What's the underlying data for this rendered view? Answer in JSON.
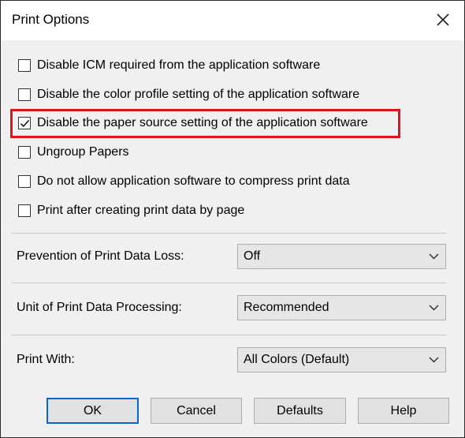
{
  "dialog": {
    "title": "Print Options",
    "close_icon": "close-icon"
  },
  "checkboxes": [
    {
      "label": "Disable ICM required from the application software",
      "checked": false
    },
    {
      "label": "Disable the color profile setting of the application software",
      "checked": false
    },
    {
      "label": "Disable the paper source setting of the application software",
      "checked": true
    },
    {
      "label": "Ungroup Papers",
      "checked": false
    },
    {
      "label": "Do not allow application software to compress print data",
      "checked": false
    },
    {
      "label": "Print after creating print data by page",
      "checked": false
    }
  ],
  "fields": {
    "prevention": {
      "label": "Prevention of Print Data Loss:",
      "value": "Off"
    },
    "unit": {
      "label": "Unit of Print Data Processing:",
      "value": "Recommended"
    },
    "print_with": {
      "label": "Print With:",
      "value": "All Colors (Default)"
    }
  },
  "buttons": {
    "ok": "OK",
    "cancel": "Cancel",
    "defaults": "Defaults",
    "help": "Help"
  },
  "colors": {
    "highlight": "#e0141e",
    "default_button_border": "#0a64d6"
  }
}
